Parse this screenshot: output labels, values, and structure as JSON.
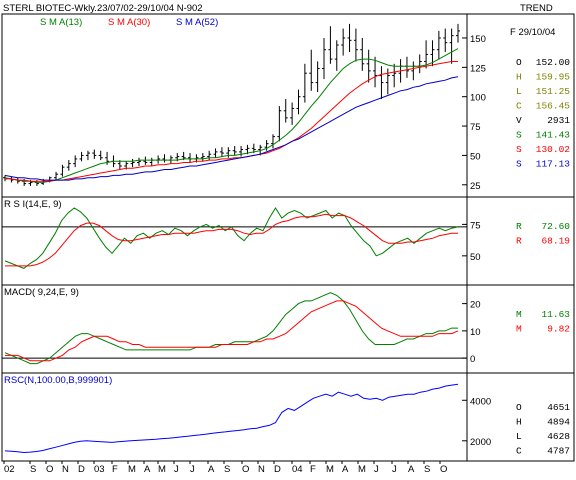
{
  "header": {
    "title": "STERL BIOTEC-Wkly.23/07/02-29/10/04  N-902",
    "trend_label": "TREND",
    "sma13_label": "S M A(13)",
    "sma30_label": "S M A(30)",
    "sma52_label": "S M A(52)"
  },
  "colors": {
    "price": "#000000",
    "sma13": "#008000",
    "sma30": "#ff0000",
    "sma52": "#0000cc",
    "rsc": "#0000ff",
    "frame": "#000000"
  },
  "price_panel": {
    "date": "F 29/10/04",
    "readout": [
      {
        "key": "O",
        "value": "152.00",
        "color": "#000000"
      },
      {
        "key": "H",
        "value": "159.95",
        "color": "#808000"
      },
      {
        "key": "L",
        "value": "151.25",
        "color": "#808000"
      },
      {
        "key": "C",
        "value": "156.45",
        "color": "#808000"
      },
      {
        "key": "V",
        "value": "2931",
        "color": "#000000"
      },
      {
        "key": "S",
        "value": "141.43",
        "color": "#008000"
      },
      {
        "key": "S",
        "value": "130.02",
        "color": "#ff0000"
      },
      {
        "key": "S",
        "value": "117.13",
        "color": "#0000cc"
      }
    ]
  },
  "rsi_panel": {
    "label": "R S I(14,E, 9)",
    "readout": [
      {
        "key": "R",
        "value": "72.60",
        "color": "#008000"
      },
      {
        "key": "R",
        "value": "68.19",
        "color": "#ff0000"
      }
    ]
  },
  "macd_panel": {
    "label": "MACD( 9,24,E, 9)",
    "readout": [
      {
        "key": "M",
        "value": "11.63",
        "color": "#008000"
      },
      {
        "key": "M",
        "value": "9.82",
        "color": "#ff0000"
      }
    ]
  },
  "rsc_panel": {
    "label": "RSC(N,100.00,B,999901)",
    "readout": [
      {
        "key": "O",
        "value": "4651",
        "color": "#000000"
      },
      {
        "key": "H",
        "value": "4894",
        "color": "#000000"
      },
      {
        "key": "L",
        "value": "4628",
        "color": "#000000"
      },
      {
        "key": "C",
        "value": "4787",
        "color": "#000000"
      }
    ]
  },
  "chart_data": [
    {
      "type": "line",
      "panel": "price",
      "title": "STERL BIOTEC-Wkly.23/07/02-29/10/04  N-902",
      "x": [
        "02",
        "S",
        "O",
        "N",
        "D",
        "03",
        "F",
        "M",
        "A",
        "M",
        "J",
        "J",
        "A",
        "S",
        "O",
        "N",
        "D",
        "04",
        "F",
        "M",
        "A",
        "M",
        "J",
        "J",
        "A",
        "S",
        "O"
      ],
      "yticks": [
        25,
        50,
        75,
        100,
        125,
        150
      ],
      "ylim": [
        18,
        167
      ],
      "bars": [
        [
          31,
          33,
          28,
          30
        ],
        [
          30,
          32,
          27,
          29
        ],
        [
          29,
          31,
          26,
          28
        ],
        [
          28,
          30,
          24,
          26
        ],
        [
          26,
          29,
          24,
          27
        ],
        [
          27,
          29,
          24,
          26
        ],
        [
          26,
          30,
          25,
          28
        ],
        [
          28,
          32,
          27,
          31
        ],
        [
          31,
          36,
          29,
          34
        ],
        [
          34,
          42,
          32,
          40
        ],
        [
          40,
          46,
          37,
          43
        ],
        [
          43,
          50,
          40,
          47
        ],
        [
          47,
          53,
          45,
          50
        ],
        [
          50,
          54,
          46,
          52
        ],
        [
          52,
          55,
          47,
          50
        ],
        [
          50,
          54,
          46,
          48
        ],
        [
          48,
          53,
          42,
          45
        ],
        [
          45,
          50,
          40,
          43
        ],
        [
          43,
          46,
          38,
          41
        ],
        [
          41,
          45,
          38,
          43
        ],
        [
          43,
          47,
          40,
          44
        ],
        [
          44,
          48,
          41,
          45
        ],
        [
          45,
          49,
          42,
          44
        ],
        [
          44,
          48,
          41,
          46
        ],
        [
          46,
          50,
          43,
          47
        ],
        [
          47,
          51,
          44,
          46
        ],
        [
          46,
          50,
          43,
          48
        ],
        [
          48,
          52,
          45,
          49
        ],
        [
          49,
          53,
          46,
          48
        ],
        [
          48,
          52,
          44,
          47
        ],
        [
          47,
          51,
          44,
          48
        ],
        [
          48,
          52,
          45,
          49
        ],
        [
          49,
          54,
          46,
          51
        ],
        [
          51,
          56,
          48,
          53
        ],
        [
          53,
          57,
          49,
          52
        ],
        [
          52,
          57,
          48,
          54
        ],
        [
          54,
          58,
          50,
          53
        ],
        [
          53,
          58,
          49,
          55
        ],
        [
          55,
          59,
          51,
          56
        ],
        [
          56,
          60,
          52,
          55
        ],
        [
          55,
          59,
          50,
          57
        ],
        [
          57,
          63,
          54,
          60
        ],
        [
          60,
          68,
          56,
          66
        ],
        [
          66,
          92,
          62,
          88
        ],
        [
          88,
          98,
          78,
          82
        ],
        [
          82,
          95,
          76,
          90
        ],
        [
          90,
          106,
          85,
          100
        ],
        [
          100,
          128,
          95,
          120
        ],
        [
          120,
          140,
          105,
          112
        ],
        [
          112,
          130,
          104,
          124
        ],
        [
          124,
          150,
          115,
          140
        ],
        [
          140,
          160,
          128,
          132
        ],
        [
          132,
          148,
          122,
          144
        ],
        [
          144,
          158,
          135,
          150
        ],
        [
          150,
          162,
          138,
          148
        ],
        [
          148,
          158,
          130,
          140
        ],
        [
          140,
          150,
          122,
          128
        ],
        [
          128,
          140,
          112,
          122
        ],
        [
          122,
          134,
          108,
          118
        ],
        [
          118,
          126,
          98,
          112
        ],
        [
          112,
          124,
          102,
          118
        ],
        [
          118,
          128,
          108,
          120
        ],
        [
          120,
          132,
          112,
          126
        ],
        [
          126,
          134,
          116,
          122
        ],
        [
          122,
          130,
          114,
          126
        ],
        [
          126,
          136,
          120,
          130
        ],
        [
          130,
          148,
          124,
          136
        ],
        [
          136,
          148,
          126,
          140
        ],
        [
          140,
          156,
          132,
          150
        ],
        [
          150,
          158,
          138,
          146
        ],
        [
          146,
          158,
          128,
          152
        ],
        [
          152,
          162,
          146,
          156
        ]
      ],
      "series": [
        {
          "name": "S M A(13)",
          "values": [
            31,
            30,
            29,
            28,
            28,
            27,
            27,
            28,
            29,
            31,
            33,
            35,
            37,
            39,
            41,
            43,
            44,
            45,
            45,
            45,
            45,
            46,
            46,
            46,
            46,
            46,
            46,
            46,
            47,
            47,
            47,
            47,
            48,
            48,
            49,
            50,
            50,
            51,
            52,
            53,
            54,
            56,
            59,
            63,
            67,
            72,
            78,
            85,
            92,
            98,
            105,
            112,
            118,
            124,
            128,
            131,
            132,
            132,
            131,
            129,
            127,
            126,
            126,
            126,
            126,
            126,
            127,
            129,
            132,
            135,
            138,
            141
          ]
        },
        {
          "name": "S M A(30)",
          "values": [
            30,
            30,
            29,
            29,
            28,
            28,
            28,
            28,
            29,
            29,
            30,
            31,
            32,
            33,
            34,
            35,
            36,
            37,
            38,
            39,
            39,
            40,
            41,
            41,
            42,
            42,
            43,
            43,
            44,
            44,
            45,
            45,
            46,
            46,
            47,
            47,
            48,
            48,
            49,
            50,
            51,
            52,
            54,
            56,
            59,
            62,
            65,
            69,
            73,
            78,
            83,
            88,
            93,
            98,
            103,
            107,
            111,
            114,
            117,
            119,
            120,
            121,
            122,
            123,
            124,
            125,
            126,
            127,
            128,
            129,
            130,
            130
          ]
        },
        {
          "name": "S M A(52)",
          "values": [
            33,
            32,
            31,
            31,
            30,
            30,
            29,
            29,
            29,
            29,
            29,
            30,
            30,
            31,
            31,
            32,
            32,
            33,
            33,
            34,
            34,
            35,
            36,
            36,
            37,
            38,
            38,
            39,
            40,
            41,
            41,
            42,
            43,
            44,
            45,
            46,
            47,
            48,
            49,
            50,
            51,
            53,
            55,
            57,
            59,
            62,
            64,
            67,
            70,
            73,
            76,
            79,
            82,
            85,
            88,
            91,
            93,
            95,
            97,
            99,
            101,
            103,
            105,
            106,
            108,
            109,
            111,
            112,
            113,
            114,
            116,
            117
          ]
        }
      ]
    },
    {
      "type": "line",
      "panel": "rsi",
      "title": "R S I(14,E, 9)",
      "yticks": [
        50,
        75
      ],
      "ylim": [
        30,
        92
      ],
      "reference": 73,
      "series": [
        {
          "name": "R",
          "values": [
            46,
            44,
            42,
            40,
            44,
            47,
            52,
            60,
            68,
            78,
            84,
            88,
            85,
            80,
            72,
            64,
            57,
            52,
            58,
            64,
            60,
            66,
            68,
            64,
            68,
            70,
            67,
            72,
            70,
            66,
            70,
            73,
            75,
            72,
            74,
            70,
            73,
            66,
            62,
            68,
            72,
            70,
            80,
            88,
            80,
            84,
            86,
            84,
            80,
            82,
            84,
            86,
            80,
            84,
            82,
            74,
            68,
            62,
            58,
            50,
            52,
            56,
            60,
            62,
            64,
            60,
            64,
            68,
            70,
            72,
            70,
            72,
            73
          ]
        },
        {
          "name": "R",
          "values": [
            42,
            42,
            42,
            42,
            42,
            43,
            45,
            48,
            52,
            58,
            64,
            70,
            74,
            76,
            76,
            74,
            70,
            66,
            63,
            62,
            62,
            63,
            64,
            65,
            66,
            67,
            67,
            68,
            68,
            68,
            68,
            69,
            70,
            70,
            71,
            71,
            71,
            70,
            68,
            67,
            68,
            68,
            71,
            75,
            77,
            78,
            80,
            81,
            81,
            81,
            82,
            83,
            82,
            82,
            82,
            80,
            77,
            74,
            70,
            66,
            62,
            60,
            60,
            60,
            61,
            61,
            62,
            63,
            64,
            66,
            67,
            68,
            68
          ]
        }
      ]
    },
    {
      "type": "line",
      "panel": "macd",
      "title": "MACD( 9,24,E, 9)",
      "yticks": [
        0,
        10,
        20
      ],
      "ylim": [
        -4,
        25
      ],
      "reference": 0,
      "series": [
        {
          "name": "M",
          "values": [
            2,
            1,
            0,
            -1,
            -2,
            -2,
            -1,
            0,
            2,
            4,
            6,
            8,
            9,
            9,
            8,
            7,
            6,
            5,
            4,
            3,
            3,
            3,
            3,
            3,
            3,
            3,
            3,
            3,
            3,
            3,
            4,
            4,
            4,
            5,
            5,
            5,
            6,
            6,
            6,
            6,
            7,
            8,
            10,
            13,
            16,
            18,
            20,
            21,
            21,
            22,
            23,
            24,
            23,
            21,
            18,
            14,
            10,
            7,
            5,
            5,
            5,
            5,
            6,
            7,
            7,
            8,
            9,
            9,
            10,
            10,
            11,
            11
          ]
        },
        {
          "name": "M",
          "values": [
            1,
            1,
            1,
            0,
            -1,
            -1,
            -1,
            -1,
            0,
            1,
            3,
            4,
            6,
            7,
            8,
            8,
            8,
            7,
            6,
            6,
            5,
            5,
            4,
            4,
            4,
            4,
            4,
            4,
            4,
            4,
            4,
            4,
            4,
            4,
            5,
            5,
            5,
            5,
            5,
            6,
            6,
            7,
            7,
            8,
            9,
            11,
            13,
            15,
            17,
            18,
            19,
            20,
            21,
            21,
            20,
            19,
            17,
            15,
            13,
            11,
            10,
            9,
            8,
            8,
            8,
            8,
            8,
            8,
            9,
            9,
            9,
            10
          ]
        }
      ]
    },
    {
      "type": "line",
      "panel": "rsc",
      "title": "RSC(N,100.00,B,999901)",
      "yticks": [
        2000,
        4000
      ],
      "ylim": [
        1200,
        5100
      ],
      "series": [
        {
          "name": "RSC",
          "values": [
            1500,
            1480,
            1460,
            1420,
            1440,
            1470,
            1520,
            1600,
            1680,
            1760,
            1840,
            1920,
            1980,
            2000,
            1980,
            1960,
            1940,
            1920,
            1950,
            1980,
            2000,
            2020,
            2040,
            2060,
            2080,
            2110,
            2130,
            2160,
            2190,
            2220,
            2260,
            2290,
            2330,
            2370,
            2410,
            2440,
            2480,
            2510,
            2550,
            2590,
            2620,
            2700,
            2760,
            2900,
            3400,
            3600,
            3500,
            3700,
            3900,
            4100,
            4200,
            4300,
            4200,
            4400,
            4300,
            4200,
            4300,
            4100,
            4050,
            4100,
            4000,
            4150,
            4200,
            4250,
            4300,
            4300,
            4400,
            4450,
            4550,
            4600,
            4700,
            4750,
            4787
          ]
        }
      ]
    }
  ]
}
